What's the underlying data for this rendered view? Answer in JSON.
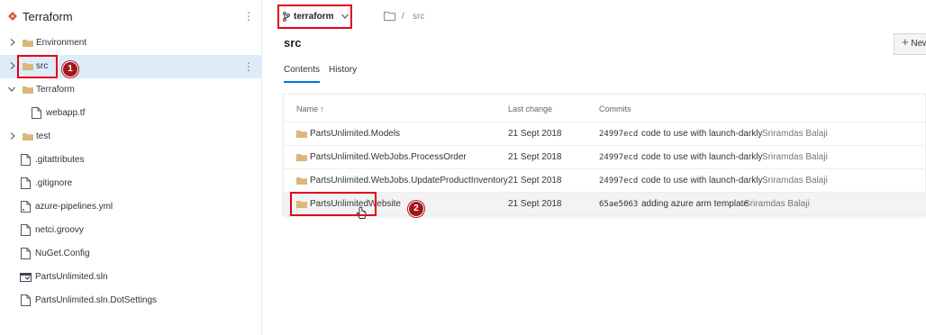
{
  "tree": {
    "repo_title": "Terraform",
    "kebab_glyph": "⋮",
    "items": [
      {
        "label": "Environment",
        "kind": "folder",
        "expanded": false
      },
      {
        "label": "src",
        "kind": "folder",
        "expanded": false,
        "selected": true
      },
      {
        "label": "Terraform",
        "kind": "folder",
        "expanded": true
      },
      {
        "label": "webapp.tf",
        "kind": "file"
      },
      {
        "label": "test",
        "kind": "folder",
        "expanded": false
      },
      {
        "label": ".gitattributes",
        "kind": "file"
      },
      {
        "label": ".gitignore",
        "kind": "file"
      },
      {
        "label": "azure-pipelines.yml",
        "kind": "file"
      },
      {
        "label": "netci.groovy",
        "kind": "file"
      },
      {
        "label": "NuGet.Config",
        "kind": "file"
      },
      {
        "label": "PartsUnlimited.sln",
        "kind": "solution-file"
      },
      {
        "label": "PartsUnlimited.sln.DotSettings",
        "kind": "file"
      }
    ]
  },
  "annotations": {
    "badge_1": "1",
    "badge_2": "2"
  },
  "header": {
    "branch": "terraform",
    "path_root_icon": "folder-outline-icon",
    "path_separator": "/",
    "path_segment": "src",
    "title": "src",
    "new_button": "New"
  },
  "tabs": [
    {
      "label": "Contents",
      "active": true
    },
    {
      "label": "History",
      "active": false
    }
  ],
  "table": {
    "columns": {
      "name": "Name ↑",
      "last_change": "Last change",
      "commits": "Commits"
    },
    "rows": [
      {
        "name": "PartsUnlimited.Models",
        "last_change": "21 Sept 2018",
        "hash": "24997ecd",
        "message": "code to use with launch-darkly",
        "author": "Sriramdas Balaji"
      },
      {
        "name": "PartsUnlimited.WebJobs.ProcessOrder",
        "last_change": "21 Sept 2018",
        "hash": "24997ecd",
        "message": "code to use with launch-darkly",
        "author": "Sriramdas Balaji"
      },
      {
        "name": "PartsUnlimited.WebJobs.UpdateProductInventory",
        "last_change": "21 Sept 2018",
        "hash": "24997ecd",
        "message": "code to use with launch-darkly",
        "author": "Sriramdas Balaji"
      },
      {
        "name": "PartsUnlimitedWebsite",
        "last_change": "21 Sept 2018",
        "hash": "65ae5063",
        "message": "adding azure arm template",
        "author": "Sriramdas Balaji"
      }
    ]
  },
  "colors": {
    "accent": "#0078d4",
    "selected_row": "#deecf9",
    "folder": "#dcb67a",
    "annotation_red": "#e2001a",
    "badge": "#a4161a",
    "repo_icon": "#e04e39"
  }
}
